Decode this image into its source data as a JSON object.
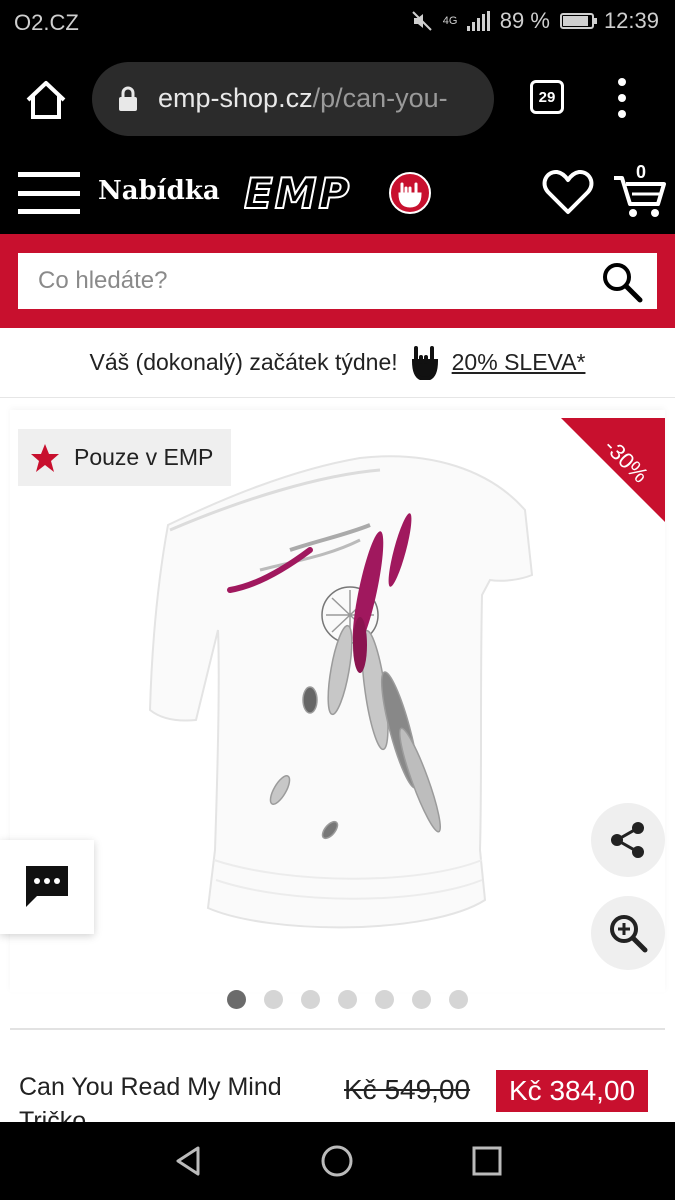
{
  "status_bar": {
    "carrier": "O2.CZ",
    "network": "4G",
    "battery": "89 %",
    "battery_level": 0.89,
    "time": "12:39"
  },
  "browser": {
    "url_host": "emp-shop.cz",
    "url_path": "/p/can-you-",
    "tab_count": "29"
  },
  "header": {
    "menu_label": "Nabídka",
    "logo_text": "EMP",
    "cart_count": "0"
  },
  "search": {
    "placeholder": "Co hledáte?"
  },
  "promo": {
    "text": "Váš (dokonalý) začátek týdne!",
    "link": "20% SLEVA*"
  },
  "gallery": {
    "exclusive_badge": "Pouze v EMP",
    "discount_badge": "-30%",
    "image_count": 7,
    "active_index": 0
  },
  "product": {
    "name": "Can You Read My Mind Tričko",
    "old_price": "Kč 549,00",
    "new_price": "Kč 384,00"
  },
  "colors": {
    "brand_red": "#c8102e",
    "black": "#000000",
    "accent_pink": "#a0185e"
  },
  "icons": [
    "home-icon",
    "lock-icon",
    "tabs-icon",
    "more-icon",
    "hamburger-icon",
    "heart-icon",
    "cart-icon",
    "search-icon",
    "rock-hand-icon",
    "star-icon",
    "share-icon",
    "zoom-in-icon",
    "chat-icon",
    "back-icon",
    "home-nav-icon",
    "recents-icon"
  ]
}
